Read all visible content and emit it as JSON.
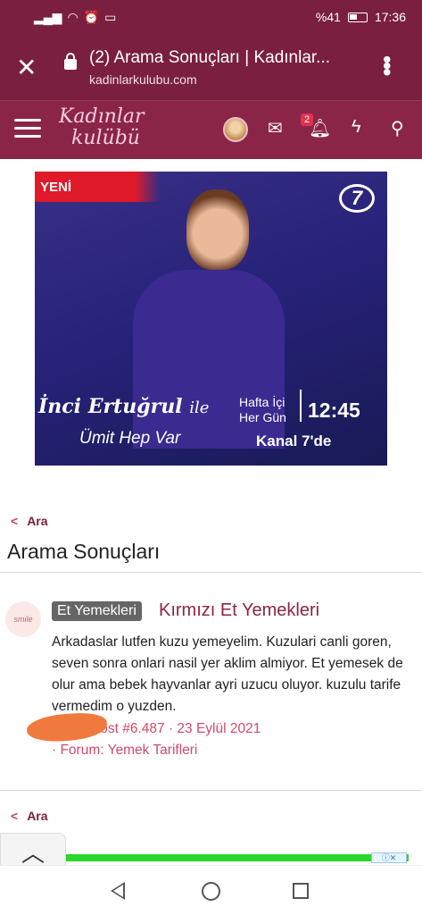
{
  "status_bar": {
    "battery_text": "%41",
    "time": "17:36"
  },
  "browser": {
    "close_glyph": "✕",
    "page_title": "(2) Arama Sonuçları | Kadınlar...",
    "domain": "kadinlarkulubu.com",
    "menu_glyph": "⋮"
  },
  "site_header": {
    "logo_line1": "Kadınlar",
    "logo_line2": "kulübü",
    "notification_count": "2",
    "icons": [
      "menu-icon",
      "avatar",
      "mail-icon",
      "bell-icon",
      "lightning-icon",
      "search-icon"
    ]
  },
  "ad": {
    "badge": "YENİ",
    "channel_logo": "7",
    "host_name": "İnci Ertuğrul",
    "host_suffix": "ile",
    "show_name": "Ümit Hep Var",
    "schedule_line1": "Hafta İçi",
    "schedule_line2": "Her Gün",
    "time": "12:45",
    "channel": "Kanal 7'de"
  },
  "breadcrumb_top": {
    "label": "Ara"
  },
  "page_title": "Arama Sonuçları",
  "result": {
    "avatar_text": "smile",
    "category_tag": "Et Yemekleri",
    "title": "Kırmızı Et Yemekleri",
    "snippet": "Arkadaslar lutfen kuzu yemeyelim. Kuzulari canli goren, seven sonra onlari nasil yer aklim almiyor. Et yemesek de olur ama bebek hayvanlar ayri uzucu oluyor. kuzulu tarife vermedim o yuzden.",
    "meta_line": "· Post #6.487 · 23 Eylül 2021",
    "forum_line": "· Forum: Yemek Tarifleri"
  },
  "breadcrumb_bottom": {
    "label": "Ara"
  },
  "ad_choices_text": "ⓘ✕"
}
